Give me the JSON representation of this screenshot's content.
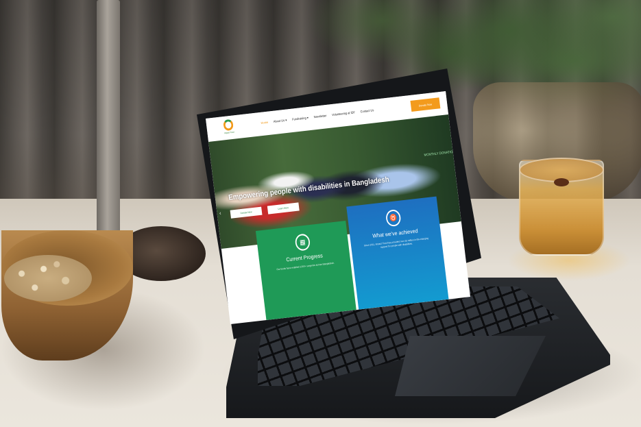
{
  "site": {
    "logo_text": "Impact Trust",
    "nav": [
      "Home",
      "About Us ▾",
      "Fundraising ▾",
      "Newsletter",
      "Volunteering at IDF",
      "Contact Us"
    ],
    "donate_label": "Donate Now",
    "hero_title": "Empowering people with disabilities in Bangladesh",
    "hero_buttons": [
      "Donate Now",
      "Learn More"
    ],
    "hero_side_text": "MONTHLY DONATION",
    "cards": [
      {
        "icon": "calendar-icon",
        "title": "Current Progress",
        "text": "Our funds have enabled 5,000+ surgeries across Bangladesh."
      },
      {
        "icon": "medal-icon",
        "title": "What we've achieved",
        "text": "Since 2011, Impact Trust has provided over £3 million in life-changing support for people with disabilities."
      }
    ],
    "colors": {
      "accent": "#f39b1d",
      "green": "#1f9a57",
      "blue": "#1e6fc0"
    }
  }
}
